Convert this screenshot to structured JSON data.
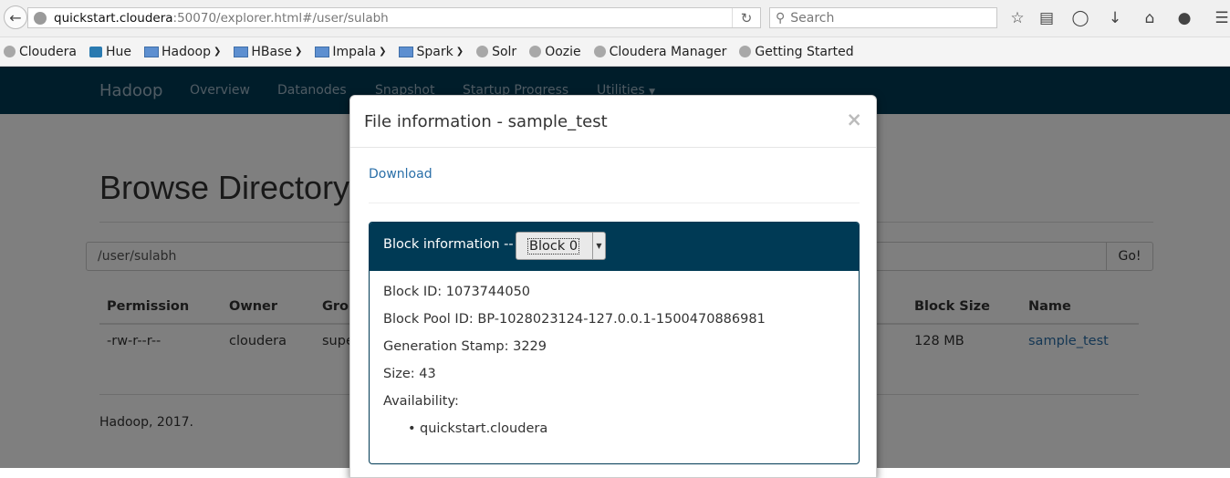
{
  "browser": {
    "url_host": "quickstart.cloudera",
    "url_rest": ":50070/explorer.html#/user/sulabh",
    "search_placeholder": "Search",
    "bookmarks": [
      {
        "label": "Cloudera",
        "icon": "globe-icon"
      },
      {
        "label": "Hue",
        "icon": "hue-icon"
      },
      {
        "label": "Hadoop",
        "icon": "folder-icon",
        "dropdown": true
      },
      {
        "label": "HBase",
        "icon": "folder-icon",
        "dropdown": true
      },
      {
        "label": "Impala",
        "icon": "folder-icon",
        "dropdown": true
      },
      {
        "label": "Spark",
        "icon": "folder-icon",
        "dropdown": true
      },
      {
        "label": "Solr",
        "icon": "globe-icon"
      },
      {
        "label": "Oozie",
        "icon": "globe-icon"
      },
      {
        "label": "Cloudera Manager",
        "icon": "globe-icon"
      },
      {
        "label": "Getting Started",
        "icon": "globe-icon"
      }
    ]
  },
  "navbar": {
    "brand": "Hadoop",
    "links": [
      "Overview",
      "Datanodes",
      "Snapshot",
      "Startup Progress",
      "Utilities"
    ],
    "bg_color": "#003a55"
  },
  "main": {
    "title": "Browse Directory",
    "path": "/user/sulabh",
    "go_label": "Go!",
    "columns": [
      "Permission",
      "Owner",
      "Group",
      "Block Size",
      "Name"
    ],
    "row": {
      "permission": "-rw-r--r--",
      "owner": "cloudera",
      "group": "supergroup",
      "block_size": "128 MB",
      "name": "sample_test"
    },
    "footer": "Hadoop, 2017."
  },
  "modal": {
    "title": "File information - sample_test",
    "close": "×",
    "download": "Download",
    "block_label": "Block information --",
    "block_selected": "Block 0",
    "block_id": "Block ID: 1073744050",
    "block_pool_id": "Block Pool ID: BP-1028023124-127.0.0.1-1500470886981",
    "generation_stamp": "Generation Stamp: 3229",
    "size": "Size: 43",
    "availability_label": "Availability:",
    "availability": [
      "quickstart.cloudera"
    ]
  }
}
